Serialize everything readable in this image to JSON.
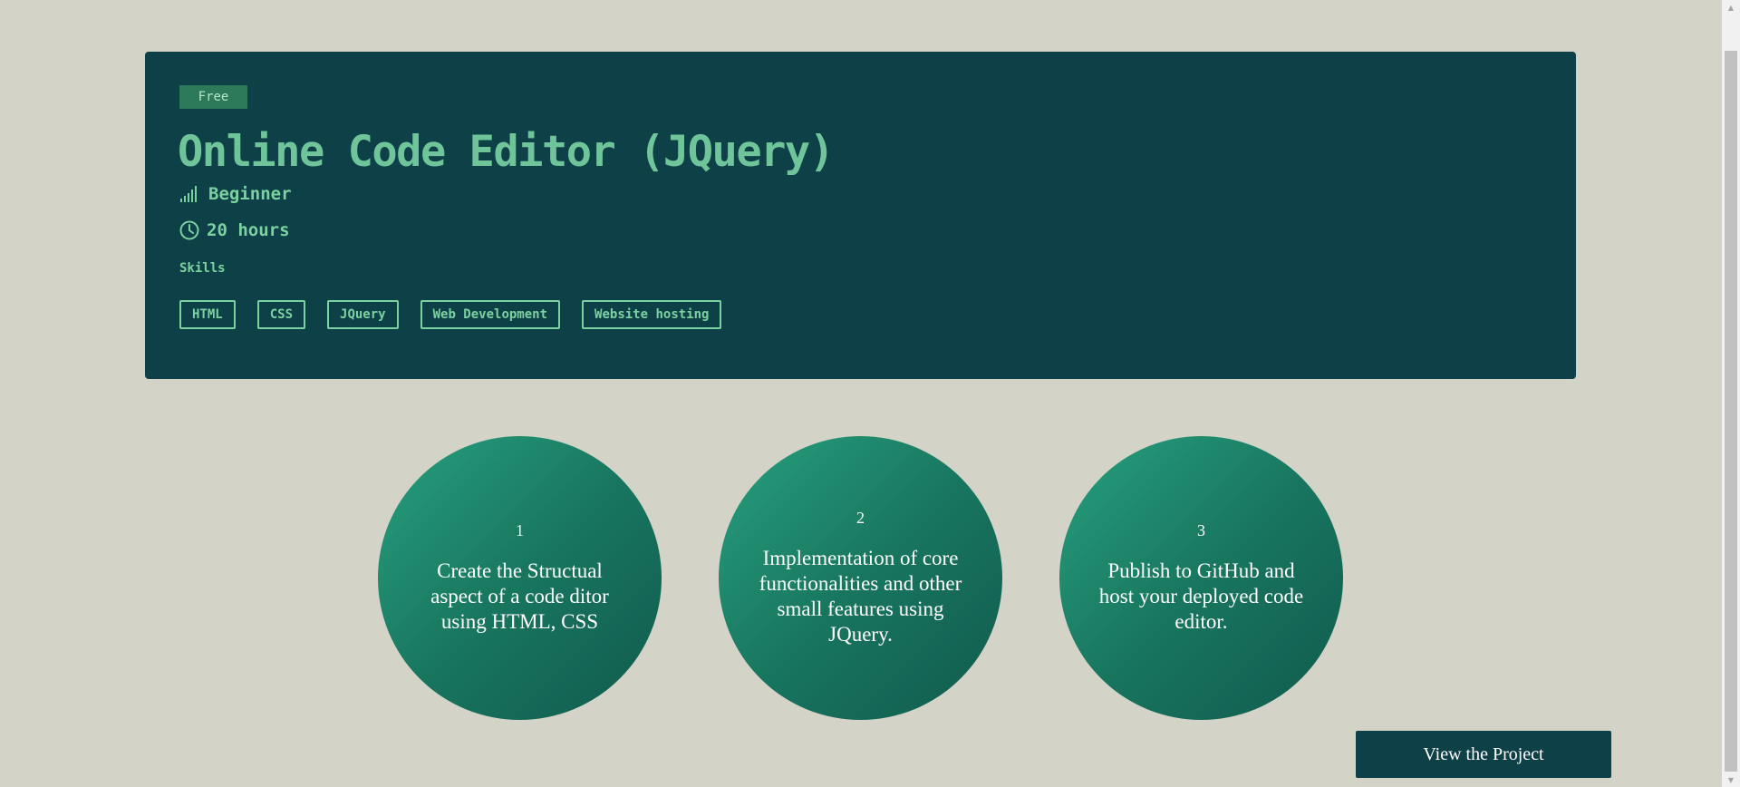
{
  "project": {
    "badge": "Free",
    "title": "Online Code Editor (JQuery)",
    "level": "Beginner",
    "duration": "20 hours",
    "skills_label": "Skills",
    "skills": [
      "HTML",
      "CSS",
      "JQuery",
      "Web Development",
      "Website hosting"
    ]
  },
  "steps": [
    {
      "number": "1",
      "text": "Create the Structual aspect of a code ditor using HTML, CSS"
    },
    {
      "number": "2",
      "text": "Implementation of core functionalities and other small features using JQuery."
    },
    {
      "number": "3",
      "text": "Publish to GitHub and host your deployed code editor."
    }
  ],
  "cta": {
    "label": "View the Project"
  },
  "icons": {
    "level": "signal-bars-icon",
    "duration": "clock-icon",
    "scroll_up": "arrow-up-icon",
    "scroll_down": "arrow-down-icon"
  },
  "colors": {
    "page_background": "#d3d3c8",
    "card_background": "#0e4047",
    "accent_green": "#7bd2a0",
    "badge_background": "#2d7a5a",
    "step_gradient_start": "#28a07f",
    "step_gradient_end": "#115a4d"
  }
}
